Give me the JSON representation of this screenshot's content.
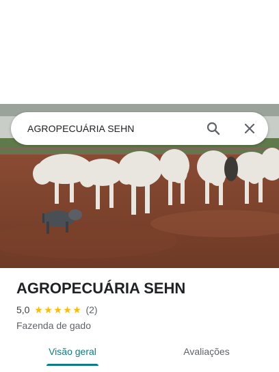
{
  "search": {
    "query": "AGROPECUÁRIA SEHN",
    "search_icon": "search-icon",
    "close_icon": "close-icon"
  },
  "place": {
    "name": "AGROPECUÁRIA SEHN",
    "rating": "5,0",
    "stars": 5,
    "review_count": "(2)",
    "category": "Fazenda de gado"
  },
  "tabs": [
    {
      "label": "Visão geral",
      "active": true
    },
    {
      "label": "Avaliações",
      "active": false
    }
  ],
  "colors": {
    "accent": "#0a7c86",
    "star": "#fbbc04",
    "text_primary": "#202124",
    "text_secondary": "#5f6368"
  }
}
